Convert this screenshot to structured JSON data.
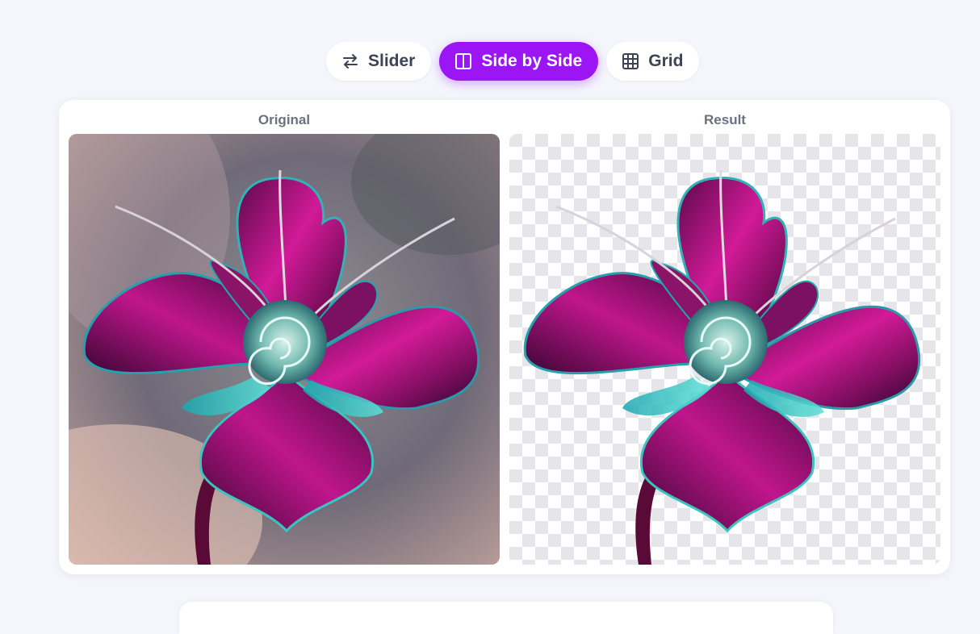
{
  "view_modes": {
    "slider_label": "Slider",
    "side_by_side_label": "Side by Side",
    "grid_label": "Grid",
    "active": "Side by Side"
  },
  "comparison": {
    "original_label": "Original",
    "result_label": "Result"
  },
  "colors": {
    "accent": "#9b15f5",
    "page_background": "#f4f6fb",
    "card_background": "#ffffff"
  },
  "icons": {
    "slider": "swap-arrows-icon",
    "side_by_side": "split-columns-icon",
    "grid": "grid-icon"
  }
}
